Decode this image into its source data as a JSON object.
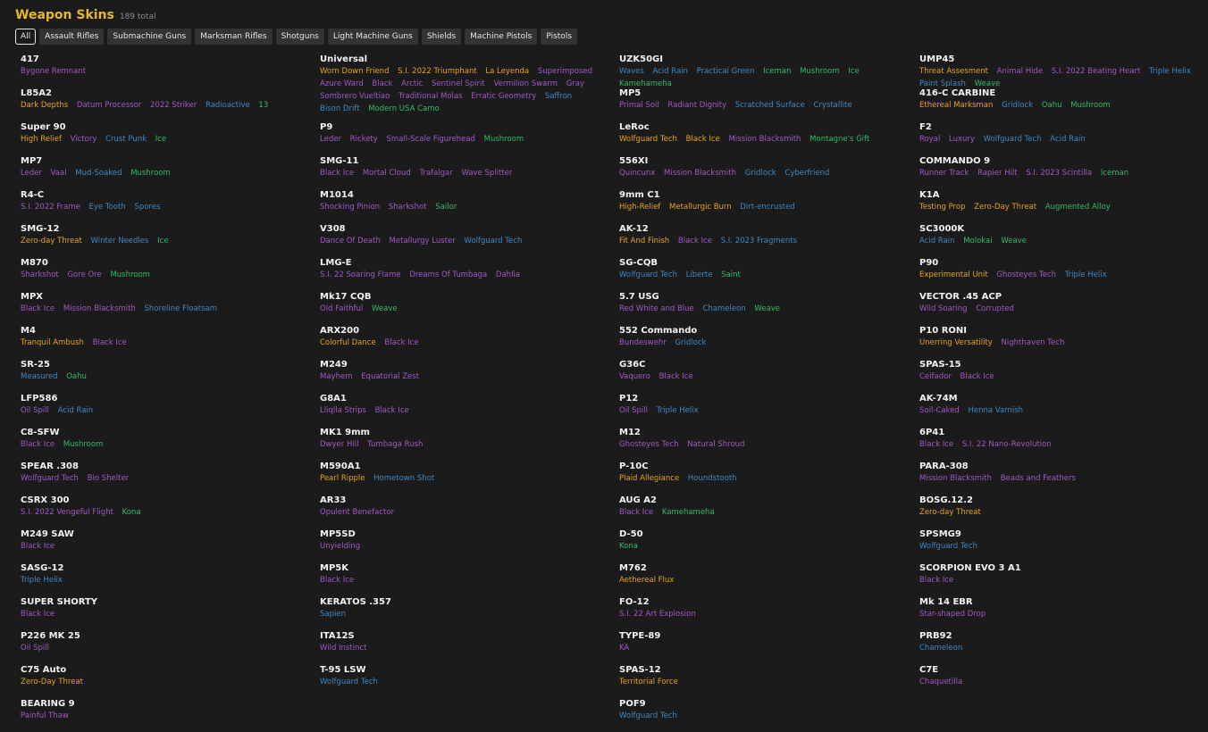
{
  "header": {
    "title": "Weapon Skins",
    "total": "189 total"
  },
  "filters": [
    "All",
    "Assault Rifles",
    "Submachine Guns",
    "Marksman Rifles",
    "Shotguns",
    "Light Machine Guns",
    "Shields",
    "Machine Pistols",
    "Pistols"
  ],
  "active_filter": "All",
  "rarity_colors": {
    "gold": "#e8a317",
    "purple": "#a157c7",
    "blue": "#3b88c7",
    "green": "#2fbc68"
  },
  "columns": [
    [
      {
        "name": "417",
        "skins": [
          [
            "Bygone Remnant",
            "purple"
          ]
        ]
      },
      {
        "name": "L85A2",
        "skins": [
          [
            "Dark Depths",
            "gold"
          ],
          [
            "Datum Processor",
            "purple"
          ],
          [
            "2022 Striker",
            "purple"
          ],
          [
            "Radioactive",
            "blue"
          ],
          [
            "13",
            "green"
          ]
        ]
      },
      {
        "name": "Super 90",
        "skins": [
          [
            "High Relief",
            "gold"
          ],
          [
            "Victory",
            "purple"
          ],
          [
            "Crust Punk",
            "blue"
          ],
          [
            "Ice",
            "green"
          ]
        ]
      },
      {
        "name": "MP7",
        "skins": [
          [
            "Leder",
            "purple"
          ],
          [
            "Vaal",
            "purple"
          ],
          [
            "Mud-Soaked",
            "blue"
          ],
          [
            "Mushroom",
            "green"
          ]
        ]
      },
      {
        "name": "R4-C",
        "skins": [
          [
            "S.I. 2022 Frame",
            "purple"
          ],
          [
            "Eye Tooth",
            "blue"
          ],
          [
            "Spores",
            "blue"
          ]
        ]
      },
      {
        "name": "SMG-12",
        "skins": [
          [
            "Zero-day Threat",
            "gold"
          ],
          [
            "Winter Needles",
            "blue"
          ],
          [
            "Ice",
            "green"
          ]
        ]
      },
      {
        "name": "M870",
        "skins": [
          [
            "Sharkshot",
            "purple"
          ],
          [
            "Gore Ore",
            "purple"
          ],
          [
            "Mushroom",
            "green"
          ]
        ]
      },
      {
        "name": "MPX",
        "skins": [
          [
            "Black Ice",
            "purple"
          ],
          [
            "Mission Blacksmith",
            "purple"
          ],
          [
            "Shoreline Floatsam",
            "blue"
          ]
        ]
      },
      {
        "name": "M4",
        "skins": [
          [
            "Tranquil Ambush",
            "gold"
          ],
          [
            "Black Ice",
            "purple"
          ]
        ]
      },
      {
        "name": "SR-25",
        "skins": [
          [
            "Measured",
            "blue"
          ],
          [
            "Oahu",
            "green"
          ]
        ]
      },
      {
        "name": "LFP586",
        "skins": [
          [
            "Oil Spill",
            "purple"
          ],
          [
            "Acid Rain",
            "blue"
          ]
        ]
      },
      {
        "name": "C8-SFW",
        "skins": [
          [
            "Black Ice",
            "purple"
          ],
          [
            "Mushroom",
            "green"
          ]
        ]
      },
      {
        "name": "SPEAR .308",
        "skins": [
          [
            "Wolfguard Tech",
            "purple"
          ],
          [
            "Bio Shelter",
            "purple"
          ]
        ]
      },
      {
        "name": "CSRX 300",
        "skins": [
          [
            "S.I. 2022 Vengeful Flight",
            "purple"
          ],
          [
            "Kona",
            "green"
          ]
        ]
      },
      {
        "name": "M249 SAW",
        "skins": [
          [
            "Black Ice",
            "purple"
          ]
        ]
      },
      {
        "name": "SASG-12",
        "skins": [
          [
            "Triple Helix",
            "blue"
          ]
        ]
      },
      {
        "name": "SUPER SHORTY",
        "skins": [
          [
            "Black Ice",
            "purple"
          ]
        ]
      },
      {
        "name": "P226 MK 25",
        "skins": [
          [
            "Oil Spill",
            "purple"
          ]
        ]
      },
      {
        "name": "C75 Auto",
        "skins": [
          [
            "Zero-Day Threat",
            "gold"
          ]
        ]
      },
      {
        "name": "BEARING 9",
        "skins": [
          [
            "Painful Thaw",
            "purple"
          ]
        ]
      }
    ],
    [
      {
        "name": "Universal",
        "skins": [
          [
            "Worn Down Friend",
            "gold"
          ],
          [
            "S.I. 2022 Triumphant",
            "gold"
          ],
          [
            "La Leyenda",
            "gold"
          ],
          [
            "Superimposed",
            "purple"
          ],
          [
            "Azure Ward",
            "purple"
          ],
          [
            "Black",
            "purple"
          ],
          [
            "Arctic",
            "purple"
          ],
          [
            "Sentinel Spirit",
            "purple"
          ],
          [
            "Vermilion Swarm",
            "purple"
          ],
          [
            "Gray",
            "purple"
          ],
          [
            "Sombrero Vueltiao",
            "purple"
          ],
          [
            "Traditional Molas",
            "purple"
          ],
          [
            "Erratic Geometry",
            "purple"
          ],
          [
            "Saffron",
            "blue"
          ],
          [
            "Bison Drift",
            "blue"
          ],
          [
            "Modern USA Camo",
            "green"
          ]
        ]
      },
      {
        "name": "P9",
        "skins": [
          [
            "Leder",
            "purple"
          ],
          [
            "Rickety",
            "purple"
          ],
          [
            "Small-Scale Figurehead",
            "purple"
          ],
          [
            "Mushroom",
            "green"
          ]
        ]
      },
      {
        "name": "SMG-11",
        "skins": [
          [
            "Black Ice",
            "purple"
          ],
          [
            "Mortal Cloud",
            "purple"
          ],
          [
            "Trafalgar",
            "purple"
          ],
          [
            "Wave Splitter",
            "purple"
          ]
        ]
      },
      {
        "name": "M1014",
        "skins": [
          [
            "Shocking Pinion",
            "purple"
          ],
          [
            "Sharkshot",
            "purple"
          ],
          [
            "Sailor",
            "green"
          ]
        ]
      },
      {
        "name": "V308",
        "skins": [
          [
            "Dance Of Death",
            "purple"
          ],
          [
            "Metallurgy Luster",
            "purple"
          ],
          [
            "Wolfguard Tech",
            "blue"
          ]
        ]
      },
      {
        "name": "LMG-E",
        "skins": [
          [
            "S.I. 22 Soaring Flame",
            "purple"
          ],
          [
            "Dreams Of Tumbaga",
            "purple"
          ],
          [
            "Dahlia",
            "purple"
          ]
        ]
      },
      {
        "name": "Mk17 CQB",
        "skins": [
          [
            "Old Faithful",
            "purple"
          ],
          [
            "Weave",
            "green"
          ]
        ]
      },
      {
        "name": "ARX200",
        "skins": [
          [
            "Colorful Dance",
            "gold"
          ],
          [
            "Black Ice",
            "purple"
          ]
        ]
      },
      {
        "name": "M249",
        "skins": [
          [
            "Mayhem",
            "purple"
          ],
          [
            "Equatorial Zest",
            "purple"
          ]
        ]
      },
      {
        "name": "G8A1",
        "skins": [
          [
            "Lliqlla Strips",
            "purple"
          ],
          [
            "Black Ice",
            "purple"
          ]
        ]
      },
      {
        "name": "MK1 9mm",
        "skins": [
          [
            "Dwyer Hill",
            "purple"
          ],
          [
            "Tumbaga Rush",
            "purple"
          ]
        ]
      },
      {
        "name": "M590A1",
        "skins": [
          [
            "Pearl Ripple",
            "gold"
          ],
          [
            "Hometown Shot",
            "blue"
          ]
        ]
      },
      {
        "name": "AR33",
        "skins": [
          [
            "Opulent Benefactor",
            "purple"
          ]
        ]
      },
      {
        "name": "MP5SD",
        "skins": [
          [
            "Unyielding",
            "purple"
          ]
        ]
      },
      {
        "name": "MP5K",
        "skins": [
          [
            "Black Ice",
            "purple"
          ]
        ]
      },
      {
        "name": "KERATOS .357",
        "skins": [
          [
            "Sapien",
            "blue"
          ]
        ]
      },
      {
        "name": "ITA12S",
        "skins": [
          [
            "Wild Instinct",
            "purple"
          ]
        ]
      },
      {
        "name": "T-95 LSW",
        "skins": [
          [
            "Wolfguard Tech",
            "blue"
          ]
        ]
      }
    ],
    [
      {
        "name": "UZK50GI",
        "skins": [
          [
            "Waves",
            "blue"
          ],
          [
            "Acid Rain",
            "blue"
          ],
          [
            "Practical Green",
            "blue"
          ],
          [
            "Iceman",
            "green"
          ],
          [
            "Mushroom",
            "green"
          ],
          [
            "Ice",
            "green"
          ],
          [
            "Kamehameha",
            "green"
          ]
        ]
      },
      {
        "name": "MP5",
        "skins": [
          [
            "Primal Soil",
            "purple"
          ],
          [
            "Radiant Dignity",
            "purple"
          ],
          [
            "Scratched Surface",
            "blue"
          ],
          [
            "Crystallite",
            "blue"
          ]
        ]
      },
      {
        "name": "LeRoc",
        "skins": [
          [
            "Wolfguard Tech",
            "gold"
          ],
          [
            "Black Ice",
            "gold"
          ],
          [
            "Mission Blacksmith",
            "purple"
          ],
          [
            "Montagne's Gift",
            "green"
          ]
        ]
      },
      {
        "name": "556XI",
        "skins": [
          [
            "Quincunx",
            "purple"
          ],
          [
            "Mission Blacksmith",
            "purple"
          ],
          [
            "Gridlock",
            "blue"
          ],
          [
            "Cyberfriend",
            "blue"
          ]
        ]
      },
      {
        "name": "9mm C1",
        "skins": [
          [
            "High-Relief",
            "gold"
          ],
          [
            "Metallurgic Burn",
            "gold"
          ],
          [
            "Dirt-encrusted",
            "blue"
          ]
        ]
      },
      {
        "name": "AK-12",
        "skins": [
          [
            "Fit And Finish",
            "gold"
          ],
          [
            "Black Ice",
            "purple"
          ],
          [
            "S.I. 2023 Fragments",
            "blue"
          ]
        ]
      },
      {
        "name": "SG-CQB",
        "skins": [
          [
            "Wolfguard Tech",
            "blue"
          ],
          [
            "Liberte",
            "blue"
          ],
          [
            "Saint",
            "green"
          ]
        ]
      },
      {
        "name": "5.7 USG",
        "skins": [
          [
            "Red White and Blue",
            "purple"
          ],
          [
            "Chameleon",
            "blue"
          ],
          [
            "Weave",
            "green"
          ]
        ]
      },
      {
        "name": "552 Commando",
        "skins": [
          [
            "Bundeswehr",
            "purple"
          ],
          [
            "Gridlock",
            "blue"
          ]
        ]
      },
      {
        "name": "G36C",
        "skins": [
          [
            "Vaquero",
            "purple"
          ],
          [
            "Black Ice",
            "purple"
          ]
        ]
      },
      {
        "name": "P12",
        "skins": [
          [
            "Oil Spill",
            "purple"
          ],
          [
            "Triple Helix",
            "blue"
          ]
        ]
      },
      {
        "name": "M12",
        "skins": [
          [
            "Ghosteyes Tech",
            "purple"
          ],
          [
            "Natural Shroud",
            "purple"
          ]
        ]
      },
      {
        "name": "P-10C",
        "skins": [
          [
            "Plaid Allegiance",
            "gold"
          ],
          [
            "Houndstooth",
            "blue"
          ]
        ]
      },
      {
        "name": "AUG A2",
        "skins": [
          [
            "Black Ice",
            "purple"
          ],
          [
            "Kamehameha",
            "green"
          ]
        ]
      },
      {
        "name": "D-50",
        "skins": [
          [
            "Kona",
            "green"
          ]
        ]
      },
      {
        "name": "M762",
        "skins": [
          [
            "Aethereal Flux",
            "gold"
          ]
        ]
      },
      {
        "name": "FO-12",
        "skins": [
          [
            "S.I. 22 Art Explosion",
            "purple"
          ]
        ]
      },
      {
        "name": "TYPE-89",
        "skins": [
          [
            "KA",
            "purple"
          ]
        ]
      },
      {
        "name": "SPAS-12",
        "skins": [
          [
            "Territorial Force",
            "gold"
          ]
        ]
      },
      {
        "name": "POF9",
        "skins": [
          [
            "Wolfguard Tech",
            "blue"
          ]
        ]
      }
    ],
    [
      {
        "name": "UMP45",
        "skins": [
          [
            "Threat Assesment",
            "gold"
          ],
          [
            "Animal Hide",
            "purple"
          ],
          [
            "S.I. 2022 Beating Heart",
            "purple"
          ],
          [
            "Triple Helix",
            "blue"
          ],
          [
            "Paint Splash",
            "blue"
          ],
          [
            "Weave",
            "green"
          ]
        ]
      },
      {
        "name": "416-C CARBINE",
        "skins": [
          [
            "Ethereal Marksman",
            "gold"
          ],
          [
            "Gridlock",
            "blue"
          ],
          [
            "Oahu",
            "green"
          ],
          [
            "Mushroom",
            "green"
          ]
        ]
      },
      {
        "name": "F2",
        "skins": [
          [
            "Royal",
            "purple"
          ],
          [
            "Luxury",
            "purple"
          ],
          [
            "Wolfguard Tech",
            "blue"
          ],
          [
            "Acid Rain",
            "blue"
          ]
        ]
      },
      {
        "name": "COMMANDO 9",
        "skins": [
          [
            "Runner Track",
            "purple"
          ],
          [
            "Rapier Hilt",
            "purple"
          ],
          [
            "S.I. 2023 Scintilla",
            "purple"
          ],
          [
            "Iceman",
            "green"
          ]
        ]
      },
      {
        "name": "K1A",
        "skins": [
          [
            "Testing Prop",
            "gold"
          ],
          [
            "Zero-Day Threat",
            "gold"
          ],
          [
            "Augmented Alloy",
            "green"
          ]
        ]
      },
      {
        "name": "SC3000K",
        "skins": [
          [
            "Acid Rain",
            "blue"
          ],
          [
            "Molokai",
            "green"
          ],
          [
            "Weave",
            "green"
          ]
        ]
      },
      {
        "name": "P90",
        "skins": [
          [
            "Experimental Unit",
            "gold"
          ],
          [
            "Ghosteyes Tech",
            "purple"
          ],
          [
            "Triple Helix",
            "blue"
          ]
        ]
      },
      {
        "name": "VECTOR .45 ACP",
        "skins": [
          [
            "Wild Soaring",
            "purple"
          ],
          [
            "Corrupted",
            "purple"
          ]
        ]
      },
      {
        "name": "P10 RONI",
        "skins": [
          [
            "Unerring Versatility",
            "gold"
          ],
          [
            "Nighthaven Tech",
            "purple"
          ]
        ]
      },
      {
        "name": "SPAS-15",
        "skins": [
          [
            "Ceifador",
            "purple"
          ],
          [
            "Black Ice",
            "purple"
          ]
        ]
      },
      {
        "name": "AK-74M",
        "skins": [
          [
            "Soil-Caked",
            "purple"
          ],
          [
            "Henna Varnish",
            "blue"
          ]
        ]
      },
      {
        "name": "6P41",
        "skins": [
          [
            "Black Ice",
            "purple"
          ],
          [
            "S.I. 22 Nano-Revolution",
            "purple"
          ]
        ]
      },
      {
        "name": "PARA-308",
        "skins": [
          [
            "Mission Blacksmith",
            "purple"
          ],
          [
            "Beads and Feathers",
            "purple"
          ]
        ]
      },
      {
        "name": "BOSG.12.2",
        "skins": [
          [
            "Zero-day Threat",
            "gold"
          ]
        ]
      },
      {
        "name": "SPSMG9",
        "skins": [
          [
            "Wolfguard Tech",
            "blue"
          ]
        ]
      },
      {
        "name": "SCORPION EVO 3 A1",
        "skins": [
          [
            "Black Ice",
            "purple"
          ]
        ]
      },
      {
        "name": "Mk 14 EBR",
        "skins": [
          [
            "Star-shaped Drop",
            "purple"
          ]
        ]
      },
      {
        "name": "PRB92",
        "skins": [
          [
            "Chameleon",
            "blue"
          ]
        ]
      },
      {
        "name": "C7E",
        "skins": [
          [
            "Chaquetilla",
            "purple"
          ]
        ]
      }
    ]
  ]
}
